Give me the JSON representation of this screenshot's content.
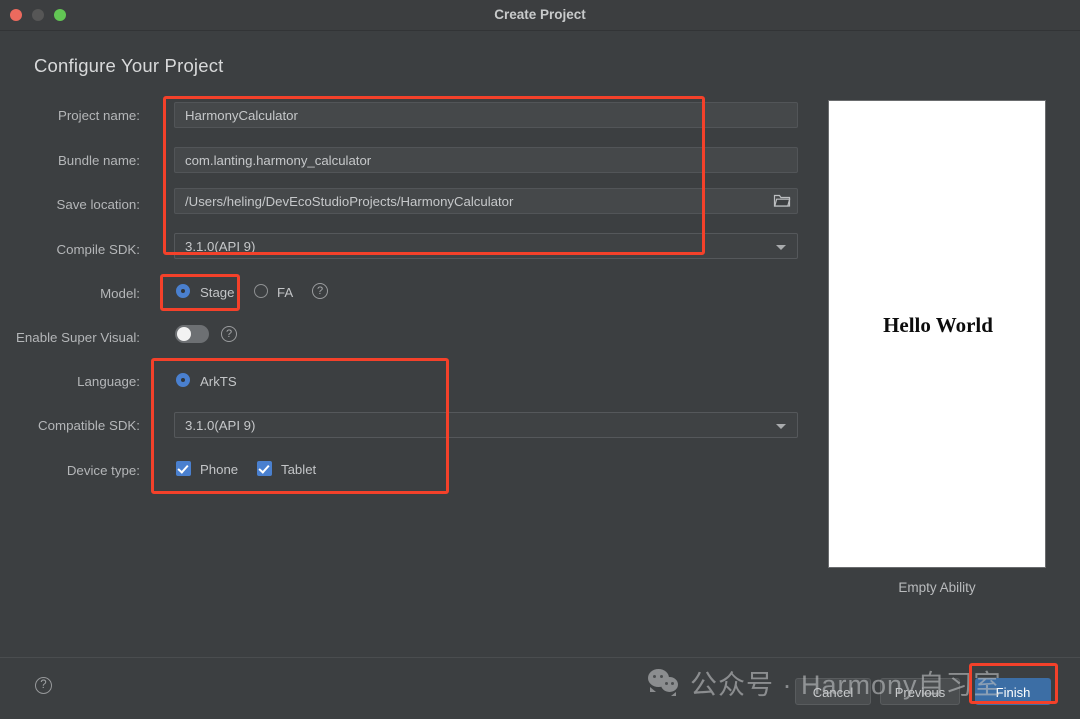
{
  "window": {
    "title": "Create Project",
    "traffic_lights": [
      "close",
      "minimize",
      "maximize"
    ]
  },
  "dialog": {
    "heading": "Configure Your Project"
  },
  "form": {
    "project_name": {
      "label": "Project name:",
      "value": "HarmonyCalculator"
    },
    "bundle_name": {
      "label": "Bundle name:",
      "value": "com.lanting.harmony_calculator"
    },
    "save_location": {
      "label": "Save location:",
      "value": "/Users/heling/DevEcoStudioProjects/HarmonyCalculator",
      "browse_icon": "folder-icon"
    },
    "compile_sdk": {
      "label": "Compile SDK:",
      "value": "3.1.0(API 9)",
      "dropdown_icon": "chevron-down-icon"
    },
    "model": {
      "label": "Model:",
      "options": [
        "Stage",
        "FA"
      ],
      "selected": "Stage",
      "help_icon": "help-icon"
    },
    "enable_super_visual": {
      "label": "Enable Super Visual:",
      "state": "off",
      "help_icon": "help-icon"
    },
    "language": {
      "label": "Language:",
      "options": [
        "ArkTS"
      ],
      "selected": "ArkTS"
    },
    "compatible_sdk": {
      "label": "Compatible SDK:",
      "value": "3.1.0(API 9)",
      "dropdown_icon": "chevron-down-icon"
    },
    "device_type": {
      "label": "Device type:",
      "options": [
        {
          "label": "Phone",
          "checked": true
        },
        {
          "label": "Tablet",
          "checked": true
        }
      ]
    }
  },
  "preview": {
    "screen_text": "Hello World",
    "caption": "Empty Ability"
  },
  "footer": {
    "help_icon": "help-icon",
    "cancel_label": "Cancel",
    "previous_label": "Previous",
    "finish_label": "Finish"
  },
  "watermark": {
    "logo": "wechat-icon",
    "text": "公众号 · Harmony自习室"
  },
  "colors": {
    "accent_blue": "#4a80cf",
    "primary_button": "#3c6ea5",
    "annotation_red": "#f4412a",
    "dialog_bg": "#3c3f41",
    "field_bg": "#45484a"
  }
}
